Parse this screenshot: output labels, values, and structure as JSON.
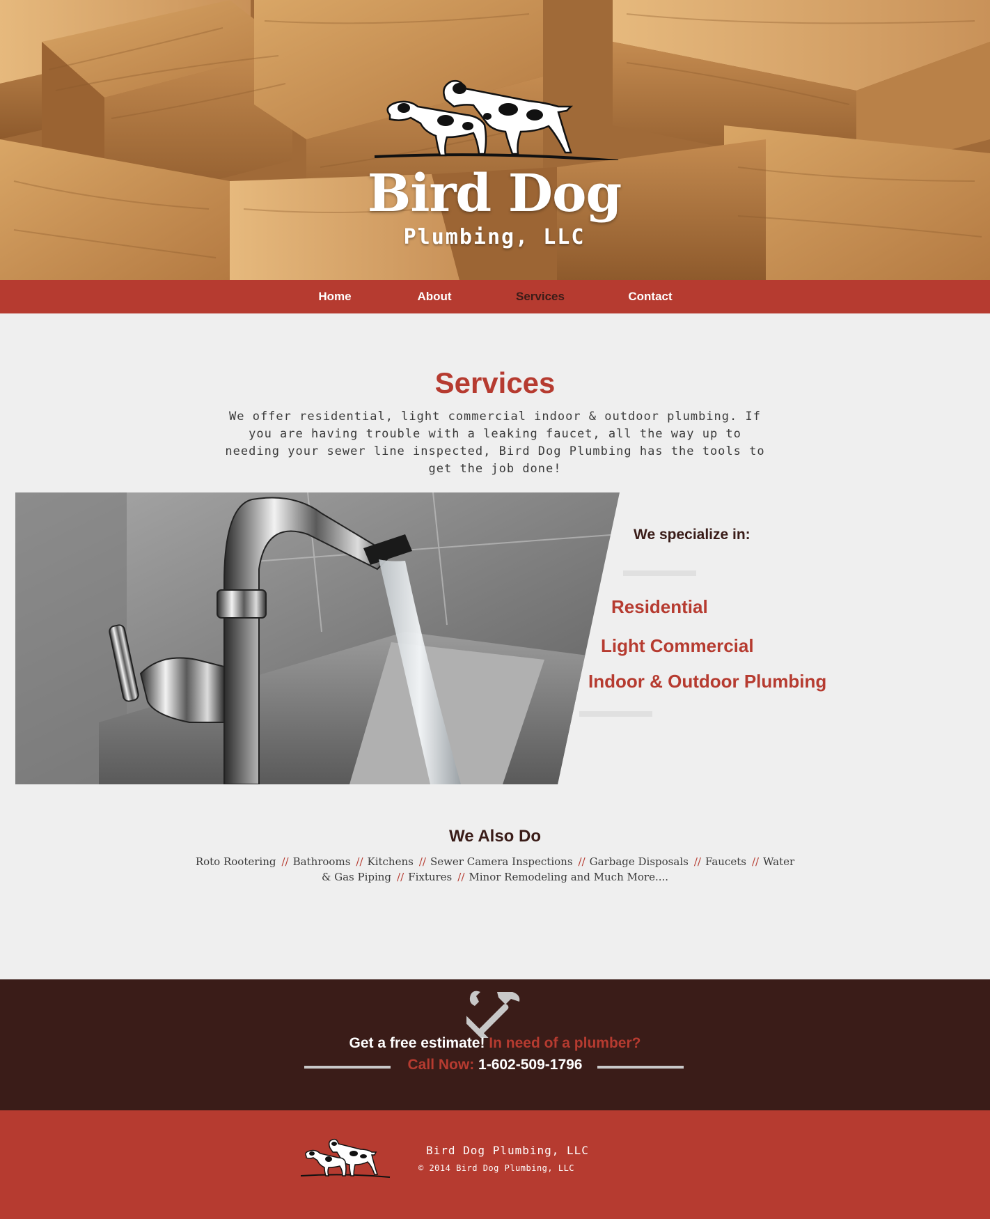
{
  "brand": {
    "title": "Bird Dog",
    "subtitle": "Plumbing, LLC"
  },
  "nav": {
    "items": [
      "Home",
      "About",
      "Services",
      "Contact"
    ],
    "active": "Services"
  },
  "services": {
    "title": "Services",
    "intro": "We offer residential, light commercial indoor & outdoor plumbing. If you are having trouble with a leaking faucet, all the way up to needing your sewer line inspected, Bird Dog Plumbing has the tools to get the job done!"
  },
  "specialize": {
    "heading": "We specialize in:",
    "items": [
      "Residential",
      "Light Commercial",
      "Indoor & Outdoor Plumbing"
    ]
  },
  "also_do": {
    "title": "We Also Do",
    "separator": "//",
    "items": [
      "Roto Rootering",
      "Bathrooms",
      "Kitchens",
      "Sewer Camera Inspections",
      "Garbage Disposals",
      "Faucets",
      "Water & Gas Piping",
      "Fixtures",
      "Minor Remodeling and Much More...."
    ]
  },
  "cta": {
    "lead": "Get a free estimate!",
    "question": "In need of a plumber?",
    "call_label": "Call Now:",
    "phone": "1-602-509-1796"
  },
  "footer": {
    "name": "Bird Dog Plumbing, LLC",
    "copyright": "© 2014 Bird Dog Plumbing, LLC"
  },
  "colors": {
    "accent_red": "#b63b30",
    "dark_brown": "#3a1c18",
    "page_bg": "#efefef"
  },
  "icons": {
    "logo": "pointer-dogs-logo",
    "cta": "wrench-hammer-icon"
  }
}
